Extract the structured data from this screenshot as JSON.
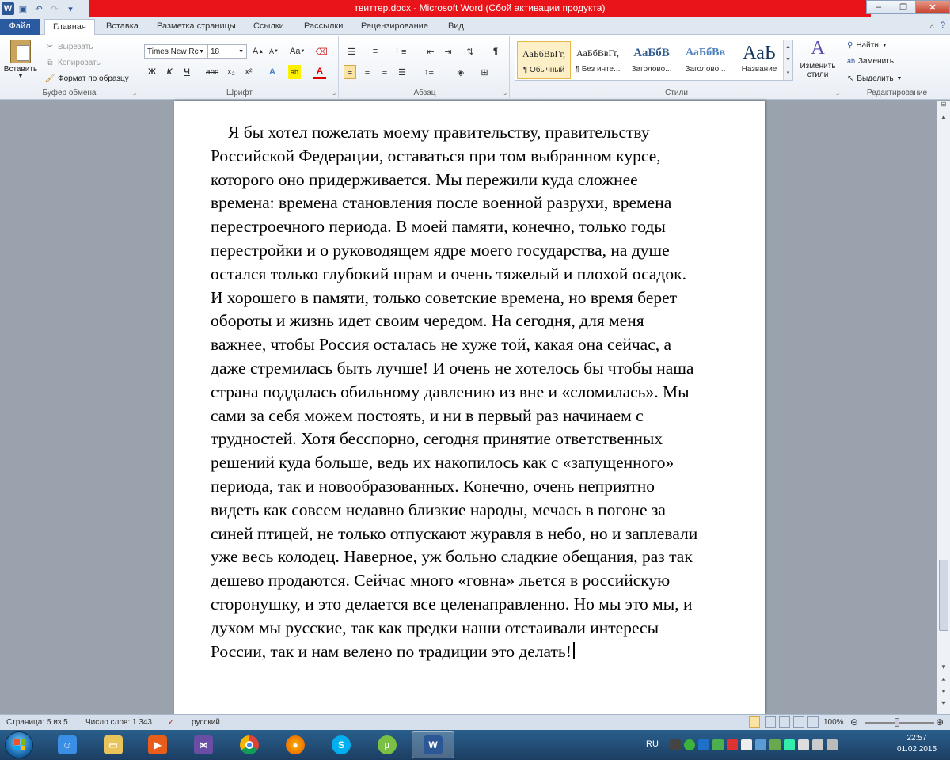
{
  "window": {
    "title": "твиттер.docx - Microsoft Word (Сбой активации продукта)",
    "minimize": "–",
    "maximize": "❐",
    "close": "✕"
  },
  "tabs": [
    "Файл",
    "Главная",
    "Вставка",
    "Разметка страницы",
    "Ссылки",
    "Рассылки",
    "Рецензирование",
    "Вид"
  ],
  "ribbon": {
    "clipboard": {
      "paste": "Вставить",
      "cut": "Вырезать",
      "copy": "Копировать",
      "format_painter": "Формат по образцу",
      "label": "Буфер обмена"
    },
    "font": {
      "name": "Times New Rc",
      "size": "18",
      "label": "Шрифт",
      "bold": "Ж",
      "italic": "К",
      "underline": "Ч",
      "strike": "abc",
      "subscript": "x₂",
      "superscript": "x²",
      "case": "Aa",
      "grow": "A",
      "shrink": "A"
    },
    "paragraph": {
      "label": "Абзац",
      "pilcrow": "¶"
    },
    "styles": {
      "label": "Стили",
      "items": [
        {
          "sample": "АаБбВвГг,",
          "name": "¶ Обычный"
        },
        {
          "sample": "АаБбВвГг,",
          "name": "¶ Без инте..."
        },
        {
          "sample": "АаБбВ",
          "name": "Заголово..."
        },
        {
          "sample": "АаБбВв",
          "name": "Заголово..."
        },
        {
          "sample": "АаЬ",
          "name": "Название"
        }
      ],
      "change_styles_1": "Изменить",
      "change_styles_2": "стили"
    },
    "editing": {
      "label": "Редактирование",
      "find": "Найти",
      "replace": "Заменить",
      "select": "Выделить"
    }
  },
  "document": {
    "lines": [
      "Я бы хотел пожелать моему правительству, правительству",
      "Российской Федерации, оставаться при том выбранном курсе,",
      "которого оно придерживается. Мы пережили куда сложнее",
      "времена: времена становления после военной разрухи, времена",
      "перестроечного периода. В моей памяти, конечно, только годы",
      "перестройки и о руководящем ядре моего государства, на душе",
      "остался только глубокий шрам и очень тяжелый и плохой осадок.",
      "И хорошего в памяти, только советские времена, но время берет",
      "обороты и жизнь идет своим чередом. На сегодня, для меня",
      "важнее, чтобы Россия осталась не хуже той, какая она сейчас, а",
      "даже стремилась быть лучше! И очень не хотелось бы чтобы наша",
      "страна поддалась обильному давлению из вне и «сломилась». Мы",
      "сами за себя можем постоять, и ни в первый раз начинаем с",
      "трудностей. Хотя бесспорно, сегодня принятие ответственных",
      "решений куда больше, ведь их накопилось как с «запущенного»",
      "периода, так и новообразованных. Конечно, очень неприятно",
      "видеть как совсем недавно близкие народы, мечась в погоне за",
      "синей птицей, не только отпускают журавля в небо, но и заплевали",
      "уже весь колодец. Наверное, уж больно сладкие обещания, раз так",
      "дешево продаются. Сейчас много «говна» льется в российскую",
      "сторонушку, и это делается все целенаправленно. Но мы это мы, и",
      "духом мы русские, так как предки наши отстаивали интересы",
      "России, так и нам велено по традиции это делать!"
    ]
  },
  "statusbar": {
    "page": "Страница: 5 из 5",
    "words": "Число слов: 1 343",
    "language": "русский",
    "zoom": "100%"
  },
  "taskbar": {
    "lang": "RU",
    "time": "22:57",
    "date": "01.02.2015"
  },
  "colors": {
    "title_bar_red": "#e8141a",
    "file_tab": "#2a5aa0",
    "taskbar": "#1c3e63"
  }
}
